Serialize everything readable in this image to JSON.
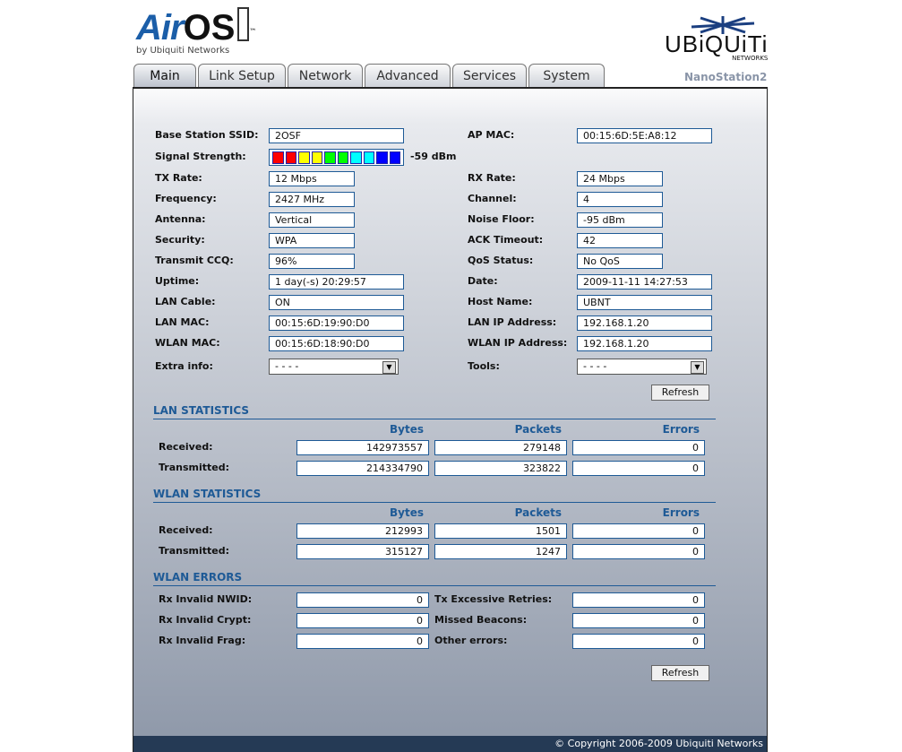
{
  "header": {
    "logo_text_air": "Air",
    "logo_text_os": "OS",
    "logo_tm": "™",
    "logo_by": "by Ubiquiti Networks",
    "brand": "UBiQUiTi",
    "brand_sub": "NETWORKS",
    "model": "NanoStation2"
  },
  "tabs": [
    {
      "label": "Main",
      "active": true
    },
    {
      "label": "Link Setup"
    },
    {
      "label": "Network"
    },
    {
      "label": "Advanced"
    },
    {
      "label": "Services"
    },
    {
      "label": "System"
    }
  ],
  "status": {
    "left": [
      {
        "label": "Base Station SSID:",
        "value": "2OSF",
        "wide": true
      },
      {
        "label": "Signal Strength:",
        "type": "signal",
        "value": "-59 dBm"
      },
      {
        "label": "TX Rate:",
        "value": "12 Mbps"
      },
      {
        "label": "Frequency:",
        "value": "2427 MHz"
      },
      {
        "label": "Antenna:",
        "value": "Vertical"
      },
      {
        "label": "Security:",
        "value": "WPA"
      },
      {
        "label": "Transmit CCQ:",
        "value": "96%"
      },
      {
        "label": "Uptime:",
        "value": "1 day(-s) 20:29:57",
        "wide": true
      },
      {
        "label": "LAN Cable:",
        "value": "ON",
        "wide": true
      },
      {
        "label": "LAN MAC:",
        "value": "00:15:6D:19:90:D0",
        "wide": true
      },
      {
        "label": "WLAN MAC:",
        "value": "00:15:6D:18:90:D0",
        "wide": true
      },
      {
        "label": "Extra info:",
        "type": "select",
        "value": "- - - -"
      }
    ],
    "right": [
      {
        "label": "AP MAC:",
        "value": "00:15:6D:5E:A8:12",
        "wide": true
      },
      null,
      {
        "label": "RX Rate:",
        "value": "24 Mbps"
      },
      {
        "label": "Channel:",
        "value": "4"
      },
      {
        "label": "Noise Floor:",
        "value": "-95 dBm"
      },
      {
        "label": "ACK Timeout:",
        "value": "42"
      },
      {
        "label": "QoS Status:",
        "value": "No QoS"
      },
      {
        "label": "Date:",
        "value": "2009-11-11 14:27:53",
        "wide": true
      },
      {
        "label": "Host Name:",
        "value": "UBNT",
        "wide": true
      },
      {
        "label": "LAN IP Address:",
        "value": "192.168.1.20",
        "wide": true
      },
      {
        "label": "WLAN IP Address:",
        "value": "192.168.1.20",
        "wide": true
      },
      {
        "label": "Tools:",
        "type": "select",
        "value": "- - - -"
      }
    ],
    "signal_bars": [
      "#ff0000",
      "#ff0000",
      "#ffff00",
      "#ffff00",
      "#00ff00",
      "#00ff00",
      "#00ffff",
      "#00ffff",
      "#0000ff",
      "#0000ff"
    ]
  },
  "refresh_label": "Refresh",
  "lan_stats": {
    "title": "LAN STATISTICS",
    "columns": [
      "Bytes",
      "Packets",
      "Errors"
    ],
    "rows": [
      {
        "label": "Received:",
        "values": [
          "142973557",
          "279148",
          "0"
        ]
      },
      {
        "label": "Transmitted:",
        "values": [
          "214334790",
          "323822",
          "0"
        ]
      }
    ]
  },
  "wlan_stats": {
    "title": "WLAN STATISTICS",
    "columns": [
      "Bytes",
      "Packets",
      "Errors"
    ],
    "rows": [
      {
        "label": "Received:",
        "values": [
          "212993",
          "1501",
          "0"
        ]
      },
      {
        "label": "Transmitted:",
        "values": [
          "315127",
          "1247",
          "0"
        ]
      }
    ]
  },
  "wlan_errors": {
    "title": "WLAN ERRORS",
    "rows": [
      {
        "l": "Rx Invalid NWID:",
        "lv": "0",
        "r": "Tx Excessive Retries:",
        "rv": "0"
      },
      {
        "l": "Rx Invalid Crypt:",
        "lv": "0",
        "r": "Missed Beacons:",
        "rv": "0"
      },
      {
        "l": "Rx Invalid Frag:",
        "lv": "0",
        "r": "Other errors:",
        "rv": "0"
      }
    ]
  },
  "footer": "© Copyright 2006-2009 Ubiquiti Networks"
}
